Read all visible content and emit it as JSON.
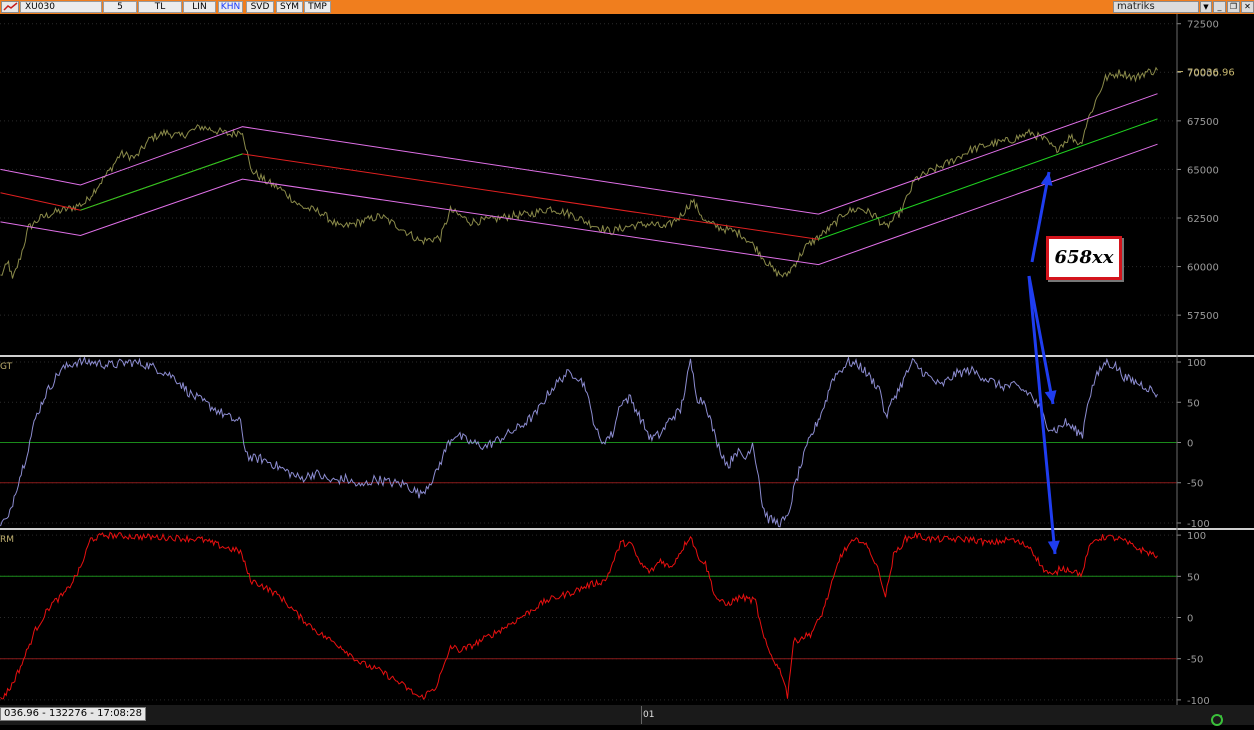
{
  "toolbar": {
    "symbol": "XU030",
    "period": "5",
    "currency": "TL",
    "scale": "LIN",
    "items": [
      "KHN",
      "SVD",
      "SYM",
      "TMP"
    ],
    "active_item": "KHN",
    "brand": "matriks"
  },
  "status": {
    "readout": "036.96 - 132276 - 17:08:28",
    "time_label": "01"
  },
  "annotation": {
    "text": "658xx",
    "arrow_color": "#1f3df0"
  },
  "colors": {
    "price": "#8a8a4a",
    "channel": "#e070e8",
    "midline": "#e02020",
    "trendline": "#20d020",
    "indicator1": "#8c8cd0",
    "indicator2": "#e81010",
    "level_green": "#1a8a1a",
    "level_red": "#8a1a1a",
    "grid": "#2a2a2a",
    "axis_text": "#9a9a9a",
    "current_price": "#c8b870"
  },
  "chart_data": [
    {
      "type": "line",
      "panel": "price",
      "ylim": [
        55500,
        73000
      ],
      "yticks": [
        "72500",
        "70000",
        "67500",
        "65000",
        "62500",
        "60000",
        "57500"
      ],
      "current_value": "70036.96",
      "series": [
        {
          "role": "price",
          "anchors": [
            [
              0,
              59500
            ],
            [
              8,
              60200
            ],
            [
              12,
              59300
            ],
            [
              20,
              60500
            ],
            [
              28,
              62000
            ],
            [
              40,
              62500
            ],
            [
              55,
              62800
            ],
            [
              70,
              63000
            ],
            [
              85,
              63300
            ],
            [
              95,
              64000
            ],
            [
              110,
              65000
            ],
            [
              120,
              65800
            ],
            [
              135,
              65600
            ],
            [
              150,
              66600
            ],
            [
              165,
              66900
            ],
            [
              180,
              66700
            ],
            [
              200,
              67200
            ],
            [
              215,
              67000
            ],
            [
              230,
              66800
            ],
            [
              242,
              67000
            ],
            [
              250,
              65000
            ],
            [
              265,
              64400
            ],
            [
              280,
              64000
            ],
            [
              300,
              63100
            ],
            [
              320,
              62800
            ],
            [
              340,
              62000
            ],
            [
              360,
              62300
            ],
            [
              380,
              62600
            ],
            [
              400,
              62000
            ],
            [
              420,
              61300
            ],
            [
              440,
              61500
            ],
            [
              450,
              62900
            ],
            [
              470,
              62300
            ],
            [
              490,
              62400
            ],
            [
              510,
              62600
            ],
            [
              530,
              62700
            ],
            [
              550,
              63000
            ],
            [
              570,
              62700
            ],
            [
              590,
              62200
            ],
            [
              610,
              61800
            ],
            [
              630,
              62100
            ],
            [
              650,
              62200
            ],
            [
              665,
              62000
            ],
            [
              680,
              62600
            ],
            [
              692,
              63400
            ],
            [
              705,
              62300
            ],
            [
              720,
              62000
            ],
            [
              740,
              61700
            ],
            [
              755,
              61000
            ],
            [
              765,
              60300
            ],
            [
              775,
              59700
            ],
            [
              785,
              59500
            ],
            [
              795,
              60200
            ],
            [
              805,
              61000
            ],
            [
              815,
              61400
            ],
            [
              830,
              62000
            ],
            [
              845,
              62800
            ],
            [
              860,
              63000
            ],
            [
              875,
              62600
            ],
            [
              885,
              62000
            ],
            [
              900,
              62800
            ],
            [
              915,
              64500
            ],
            [
              930,
              64900
            ],
            [
              950,
              65400
            ],
            [
              970,
              66000
            ],
            [
              990,
              66300
            ],
            [
              1010,
              66500
            ],
            [
              1030,
              66900
            ],
            [
              1045,
              66500
            ],
            [
              1055,
              66000
            ],
            [
              1070,
              66700
            ],
            [
              1080,
              66300
            ],
            [
              1087,
              67500
            ],
            [
              1095,
              68500
            ],
            [
              1105,
              69700
            ],
            [
              1120,
              70000
            ],
            [
              1135,
              69700
            ],
            [
              1145,
              70000
            ],
            [
              1157,
              70100
            ]
          ]
        },
        {
          "role": "channel-upper",
          "anchors": [
            [
              0,
              65000
            ],
            [
              80,
              64200
            ],
            [
              242,
              67200
            ],
            [
              818,
              62700
            ],
            [
              1157,
              68900
            ]
          ]
        },
        {
          "role": "channel-lower",
          "anchors": [
            [
              0,
              62300
            ],
            [
              80,
              61600
            ],
            [
              242,
              64500
            ],
            [
              818,
              60100
            ],
            [
              1157,
              66300
            ]
          ]
        },
        {
          "role": "midline",
          "anchors": [
            [
              0,
              63800
            ],
            [
              80,
              62900
            ],
            [
              242,
              65800
            ],
            [
              818,
              61400
            ]
          ]
        },
        {
          "role": "trendline",
          "anchors": [
            [
              80,
              62900
            ],
            [
              242,
              65800
            ]
          ]
        },
        {
          "role": "trendline",
          "anchors": [
            [
              818,
              61400
            ],
            [
              1157,
              67600
            ]
          ]
        }
      ]
    },
    {
      "type": "line",
      "panel": "indicator1",
      "series_label": "GT",
      "ylim": [
        -105,
        105
      ],
      "yticks": [
        "100",
        "50",
        "0",
        "-50",
        "-100"
      ],
      "levels": [
        0,
        -50
      ],
      "anchors": [
        [
          0,
          -100
        ],
        [
          8,
          -95
        ],
        [
          15,
          -60
        ],
        [
          25,
          -20
        ],
        [
          35,
          30
        ],
        [
          45,
          60
        ],
        [
          60,
          90
        ],
        [
          75,
          100
        ],
        [
          90,
          100
        ],
        [
          110,
          96
        ],
        [
          130,
          100
        ],
        [
          145,
          97
        ],
        [
          160,
          90
        ],
        [
          175,
          80
        ],
        [
          190,
          60
        ],
        [
          210,
          45
        ],
        [
          230,
          30
        ],
        [
          240,
          25
        ],
        [
          245,
          -10
        ],
        [
          250,
          -20
        ],
        [
          260,
          -20
        ],
        [
          270,
          -25
        ],
        [
          285,
          -35
        ],
        [
          300,
          -45
        ],
        [
          315,
          -38
        ],
        [
          330,
          -48
        ],
        [
          345,
          -45
        ],
        [
          360,
          -55
        ],
        [
          375,
          -45
        ],
        [
          390,
          -50
        ],
        [
          405,
          -52
        ],
        [
          420,
          -65
        ],
        [
          435,
          -40
        ],
        [
          448,
          0
        ],
        [
          455,
          10
        ],
        [
          470,
          0
        ],
        [
          485,
          -5
        ],
        [
          500,
          5
        ],
        [
          520,
          20
        ],
        [
          535,
          35
        ],
        [
          550,
          65
        ],
        [
          565,
          85
        ],
        [
          575,
          85
        ],
        [
          585,
          70
        ],
        [
          590,
          40
        ],
        [
          600,
          0
        ],
        [
          612,
          10
        ],
        [
          620,
          50
        ],
        [
          630,
          55
        ],
        [
          640,
          30
        ],
        [
          650,
          5
        ],
        [
          660,
          10
        ],
        [
          670,
          30
        ],
        [
          680,
          40
        ],
        [
          690,
          100
        ],
        [
          697,
          55
        ],
        [
          705,
          50
        ],
        [
          715,
          5
        ],
        [
          720,
          -10
        ],
        [
          728,
          -30
        ],
        [
          735,
          -10
        ],
        [
          745,
          -20
        ],
        [
          752,
          0
        ],
        [
          758,
          -40
        ],
        [
          762,
          -80
        ],
        [
          768,
          -95
        ],
        [
          778,
          -100
        ],
        [
          787,
          -95
        ],
        [
          793,
          -60
        ],
        [
          800,
          -30
        ],
        [
          808,
          0
        ],
        [
          815,
          20
        ],
        [
          825,
          50
        ],
        [
          832,
          80
        ],
        [
          840,
          90
        ],
        [
          848,
          100
        ],
        [
          860,
          95
        ],
        [
          870,
          80
        ],
        [
          880,
          65
        ],
        [
          885,
          30
        ],
        [
          893,
          55
        ],
        [
          900,
          70
        ],
        [
          912,
          100
        ],
        [
          925,
          85
        ],
        [
          940,
          70
        ],
        [
          955,
          85
        ],
        [
          970,
          90
        ],
        [
          985,
          80
        ],
        [
          1000,
          70
        ],
        [
          1015,
          70
        ],
        [
          1030,
          60
        ],
        [
          1040,
          40
        ],
        [
          1048,
          20
        ],
        [
          1055,
          15
        ],
        [
          1065,
          25
        ],
        [
          1075,
          15
        ],
        [
          1082,
          10
        ],
        [
          1087,
          50
        ],
        [
          1095,
          80
        ],
        [
          1105,
          100
        ],
        [
          1115,
          95
        ],
        [
          1125,
          80
        ],
        [
          1135,
          75
        ],
        [
          1145,
          70
        ],
        [
          1157,
          60
        ]
      ]
    },
    {
      "type": "line",
      "panel": "indicator2",
      "series_label": "RM",
      "ylim": [
        -105,
        105
      ],
      "yticks": [
        "100",
        "50",
        "0",
        "-50",
        "-100"
      ],
      "levels": [
        50,
        -50
      ],
      "anchors": [
        [
          0,
          -100
        ],
        [
          10,
          -85
        ],
        [
          20,
          -60
        ],
        [
          35,
          -15
        ],
        [
          50,
          15
        ],
        [
          65,
          30
        ],
        [
          80,
          60
        ],
        [
          90,
          95
        ],
        [
          105,
          100
        ],
        [
          140,
          98
        ],
        [
          170,
          97
        ],
        [
          200,
          95
        ],
        [
          225,
          85
        ],
        [
          240,
          80
        ],
        [
          250,
          45
        ],
        [
          260,
          40
        ],
        [
          280,
          25
        ],
        [
          300,
          0
        ],
        [
          320,
          -20
        ],
        [
          340,
          -35
        ],
        [
          360,
          -55
        ],
        [
          380,
          -65
        ],
        [
          400,
          -80
        ],
        [
          420,
          -98
        ],
        [
          435,
          -85
        ],
        [
          445,
          -55
        ],
        [
          450,
          -35
        ],
        [
          460,
          -40
        ],
        [
          470,
          -35
        ],
        [
          485,
          -25
        ],
        [
          500,
          -15
        ],
        [
          520,
          0
        ],
        [
          545,
          20
        ],
        [
          570,
          30
        ],
        [
          590,
          40
        ],
        [
          605,
          45
        ],
        [
          612,
          65
        ],
        [
          620,
          90
        ],
        [
          630,
          90
        ],
        [
          640,
          65
        ],
        [
          650,
          55
        ],
        [
          660,
          70
        ],
        [
          670,
          60
        ],
        [
          680,
          80
        ],
        [
          690,
          100
        ],
        [
          697,
          75
        ],
        [
          705,
          65
        ],
        [
          715,
          25
        ],
        [
          725,
          15
        ],
        [
          740,
          25
        ],
        [
          755,
          20
        ],
        [
          762,
          -20
        ],
        [
          768,
          -40
        ],
        [
          775,
          -55
        ],
        [
          782,
          -70
        ],
        [
          787,
          -95
        ],
        [
          793,
          -30
        ],
        [
          800,
          -25
        ],
        [
          810,
          -20
        ],
        [
          820,
          0
        ],
        [
          830,
          35
        ],
        [
          840,
          75
        ],
        [
          850,
          90
        ],
        [
          860,
          95
        ],
        [
          870,
          80
        ],
        [
          880,
          50
        ],
        [
          885,
          25
        ],
        [
          893,
          75
        ],
        [
          905,
          95
        ],
        [
          915,
          100
        ],
        [
          930,
          95
        ],
        [
          950,
          95
        ],
        [
          970,
          95
        ],
        [
          990,
          90
        ],
        [
          1010,
          95
        ],
        [
          1030,
          85
        ],
        [
          1042,
          60
        ],
        [
          1052,
          50
        ],
        [
          1060,
          60
        ],
        [
          1070,
          58
        ],
        [
          1082,
          52
        ],
        [
          1087,
          80
        ],
        [
          1095,
          95
        ],
        [
          1105,
          98
        ],
        [
          1120,
          95
        ],
        [
          1135,
          85
        ],
        [
          1145,
          80
        ],
        [
          1157,
          75
        ]
      ]
    }
  ]
}
